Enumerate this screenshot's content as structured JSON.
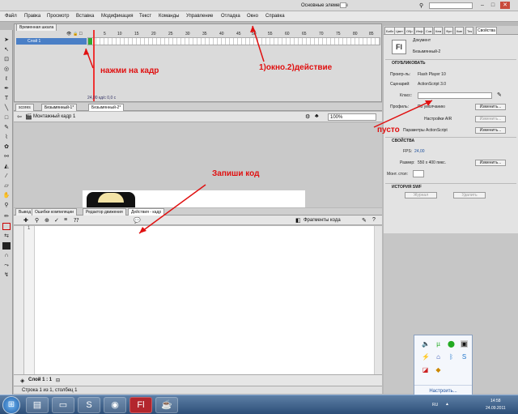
{
  "window": {
    "workspace": "Основные элементы",
    "min": "–",
    "max": "□",
    "close": "✕"
  },
  "menu": [
    "Файл",
    "Правка",
    "Просмотр",
    "Вставка",
    "Модификация",
    "Текст",
    "Команды",
    "Управление",
    "Отладка",
    "Окно",
    "Справка"
  ],
  "timeline": {
    "tab": "Временная шкала",
    "layer_name": "Слой 1",
    "frame_numbers": [
      "5",
      "10",
      "15",
      "20",
      "25",
      "30",
      "35",
      "40",
      "45",
      "50",
      "55",
      "60",
      "65",
      "70",
      "75",
      "80",
      "85"
    ],
    "status": "24,00 кд/с  0,0 с"
  },
  "doc_tabs": [
    "scores",
    "Безымянный-1*",
    "Безымянный-2*"
  ],
  "editbar": {
    "scene": "Монтажный кадр 1",
    "zoom": "100%"
  },
  "actions": {
    "tabs": [
      "Вывод",
      "Ошибки компиляции",
      "Редактор движения",
      "Действия - кадр"
    ],
    "snippets": "Фрагменты кода",
    "line_number": "1",
    "script_tab": "Слой 1 : 1",
    "status_line": "Строка 1 из 1, столбец 1"
  },
  "right_panel": {
    "tabs": [
      "Библ",
      "Цвет",
      "Обр",
      "Инф",
      "Сов",
      "Кем",
      "Фрн",
      "Кмп",
      "Тек",
      "Свойства"
    ],
    "doc_type": "Документ",
    "doc_name": "Безымянный-2",
    "section_publish": "ОПУБЛИКОВАТЬ",
    "player_label": "Проигр-ль:",
    "player_value": "Flash Player 10",
    "script_label": "Сценарий:",
    "script_value": "ActionScript 3.0",
    "class_label": "Класс:",
    "profile_label": "Профиль:",
    "profile_value": "По умолчанию",
    "edit_btn": "Изменить...",
    "air_label": "Настройки AIR",
    "as_params": "Параметры ActionScript",
    "section_props": "СВОЙСТВА",
    "fps_label": "FPS:",
    "fps_value": "24,00",
    "size_label": "Размер:",
    "size_value": "550 x 400 пикс.",
    "stage_label": "Монт. стол:",
    "section_history": "ИСТОРИЯ SWF",
    "history_log": "Журнал",
    "history_clear": "Удалить"
  },
  "tray_popup": {
    "customize": "Настроить..."
  },
  "taskbar": {
    "lang": "RU",
    "time": "14:58",
    "date": "24.09.2011"
  },
  "annotations": {
    "click_frame": "нажми на кадр",
    "window_action": "1)окно.2)действие",
    "empty": "пусто",
    "write_code": "Запиши код"
  },
  "colors": {
    "annotation": "#e01010",
    "layer_selected": "#4a7fc6"
  }
}
